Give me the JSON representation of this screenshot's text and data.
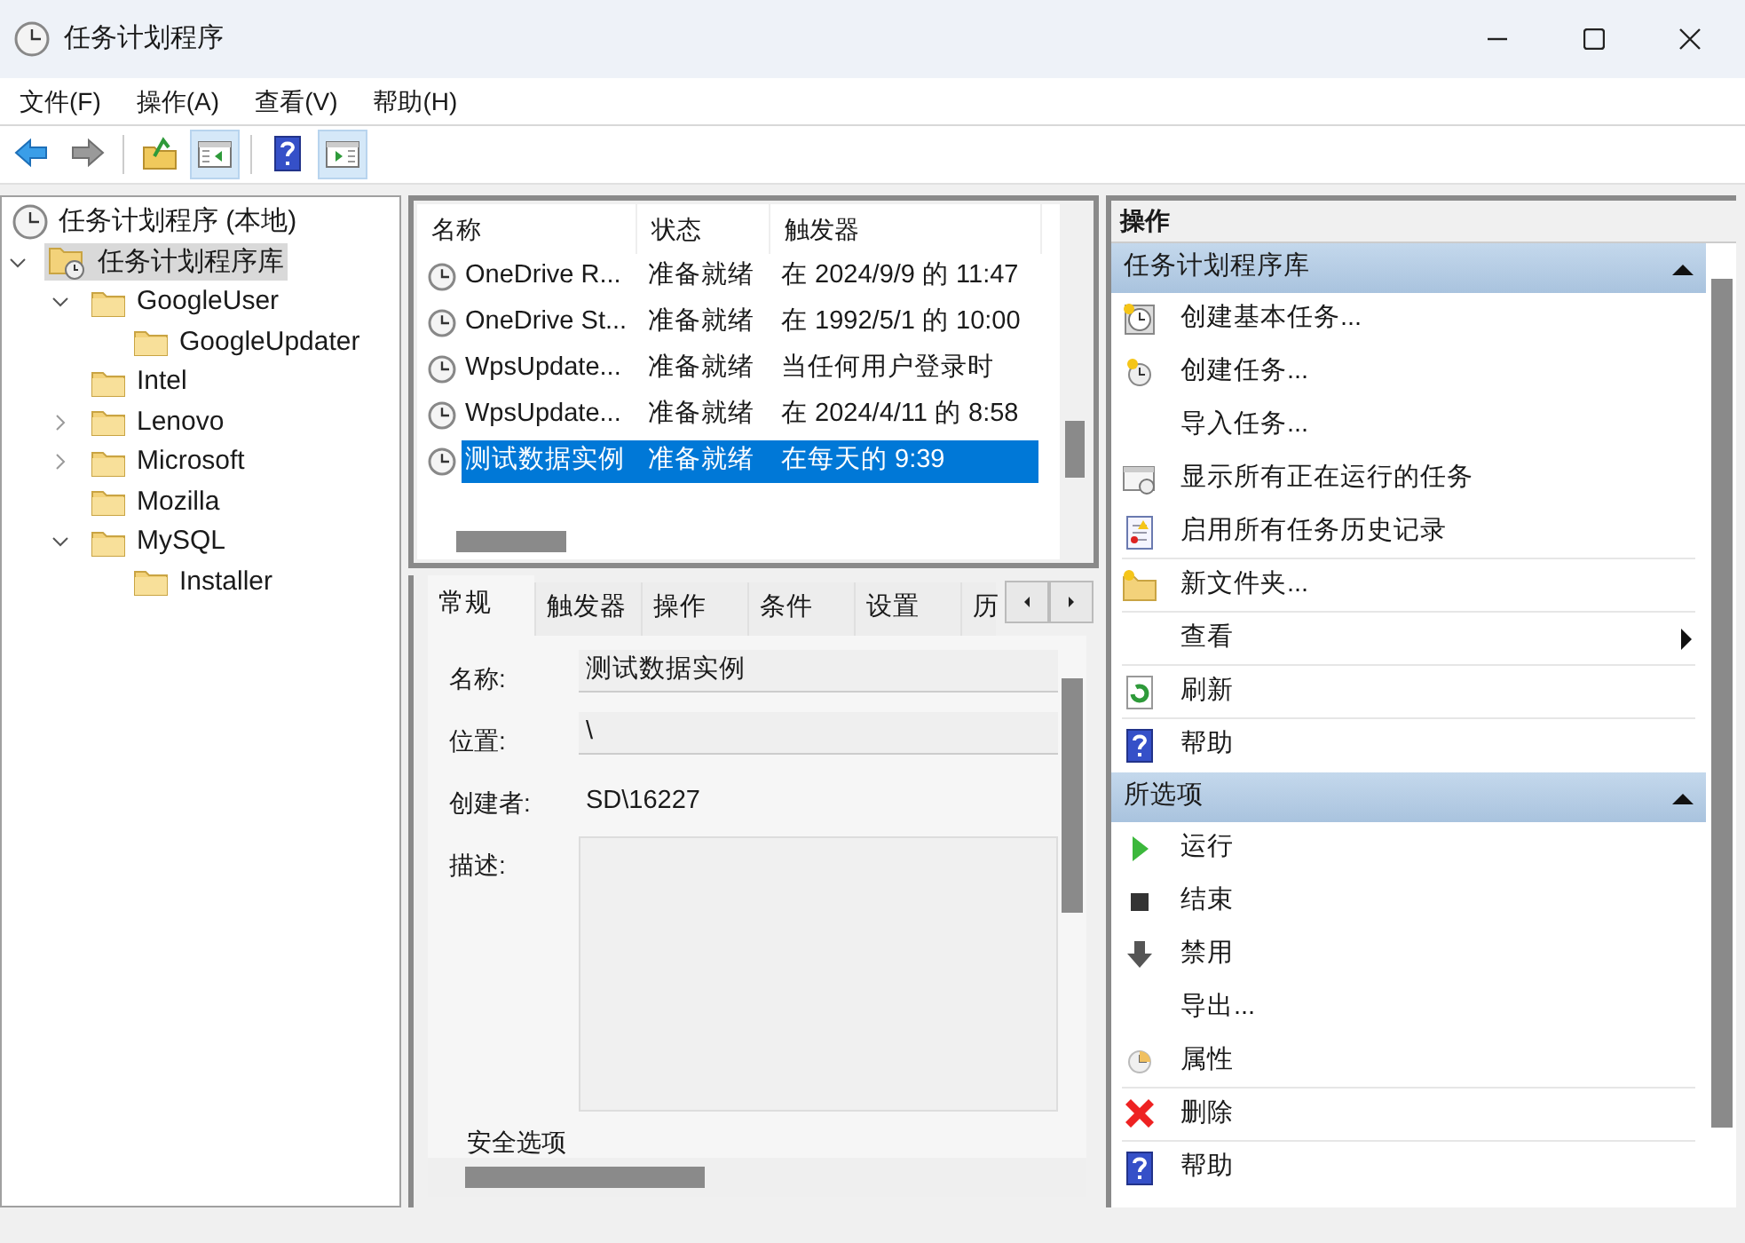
{
  "window": {
    "title": "任务计划程序"
  },
  "menu": [
    "文件(F)",
    "操作(A)",
    "查看(V)",
    "帮助(H)"
  ],
  "toolbar": [
    {
      "kind": "back",
      "pressed": false
    },
    {
      "kind": "forward",
      "pressed": false
    },
    {
      "kind": "up",
      "pressed": false
    },
    {
      "kind": "tree-pane",
      "pressed": true
    },
    {
      "kind": "help",
      "pressed": false
    },
    {
      "kind": "action-pane",
      "pressed": true
    }
  ],
  "tree": [
    {
      "label": "任务计划程序 (本地)",
      "kind": "root",
      "selected": false,
      "children": [
        {
          "label": "任务计划程序库",
          "kind": "library",
          "expanded": true,
          "selected": true,
          "children": [
            {
              "label": "GoogleUser",
              "kind": "folder",
              "expanded": true,
              "selected": false,
              "children": [
                {
                  "label": "GoogleUpdater",
                  "kind": "folder",
                  "selected": false
                }
              ]
            },
            {
              "label": "Intel",
              "kind": "folder",
              "selected": false
            },
            {
              "label": "Lenovo",
              "kind": "folder",
              "expanded": false,
              "selected": false
            },
            {
              "label": "Microsoft",
              "kind": "folder",
              "expanded": false,
              "selected": false
            },
            {
              "label": "Mozilla",
              "kind": "folder",
              "selected": false
            },
            {
              "label": "MySQL",
              "kind": "folder",
              "expanded": true,
              "selected": false,
              "children": [
                {
                  "label": "Installer",
                  "kind": "folder",
                  "selected": false
                }
              ]
            }
          ]
        }
      ]
    }
  ],
  "task_list": {
    "columns": [
      "名称",
      "状态",
      "触发器"
    ],
    "rows": [
      {
        "name": "OneDrive R...",
        "status": "准备就绪",
        "trigger": "在 2024/9/9 的 11:47",
        "selected": false
      },
      {
        "name": "OneDrive St...",
        "status": "准备就绪",
        "trigger": "在 1992/5/1 的 10:00",
        "selected": false
      },
      {
        "name": "WpsUpdate...",
        "status": "准备就绪",
        "trigger": "当任何用户登录时",
        "selected": false
      },
      {
        "name": "WpsUpdate...",
        "status": "准备就绪",
        "trigger": "在 2024/4/11 的 8:58",
        "selected": false
      },
      {
        "name": "测试数据实例",
        "status": "准备就绪",
        "trigger": "在每天的 9:39",
        "selected": true
      }
    ]
  },
  "details": {
    "tabs": [
      {
        "label": "常规",
        "selected": true
      },
      {
        "label": "触发器",
        "selected": false
      },
      {
        "label": "操作",
        "selected": false
      },
      {
        "label": "条件",
        "selected": false
      },
      {
        "label": "设置",
        "selected": false
      },
      {
        "label": "历",
        "selected": false
      }
    ],
    "fields": [
      {
        "label": "名称:",
        "value": "测试数据实例",
        "kind": "field"
      },
      {
        "label": "位置:",
        "value": "\\",
        "kind": "field"
      },
      {
        "label": "创建者:",
        "value": "SD\\16227",
        "kind": "text"
      },
      {
        "label": "描述:",
        "kind": "area"
      }
    ],
    "section": "安全选项"
  },
  "actions": {
    "title": "操作",
    "sections": [
      {
        "title": "任务计划程序库",
        "expanded": true,
        "items": [
          {
            "label": "创建基本任务...",
            "kind": "basic-task",
            "submenu": false,
            "divider": false
          },
          {
            "label": "创建任务...",
            "kind": "task",
            "submenu": false,
            "divider": false
          },
          {
            "label": "导入任务...",
            "kind": "plain",
            "submenu": false,
            "divider": false
          },
          {
            "label": "显示所有正在运行的任务",
            "kind": "running",
            "submenu": false,
            "divider": false
          },
          {
            "label": "启用所有任务历史记录",
            "kind": "history",
            "submenu": false,
            "divider": true
          },
          {
            "label": "新文件夹...",
            "kind": "new-folder",
            "submenu": false,
            "divider": true
          },
          {
            "label": "查看",
            "kind": "plain",
            "submenu": true,
            "divider": true
          },
          {
            "label": "刷新",
            "kind": "refresh",
            "submenu": false,
            "divider": true
          },
          {
            "label": "帮助",
            "kind": "help",
            "submenu": false,
            "divider": false
          }
        ]
      },
      {
        "title": "所选项",
        "expanded": true,
        "items": [
          {
            "label": "运行",
            "kind": "run",
            "submenu": false,
            "divider": false
          },
          {
            "label": "结束",
            "kind": "stop",
            "submenu": false,
            "divider": false
          },
          {
            "label": "禁用",
            "kind": "disable",
            "submenu": false,
            "divider": false
          },
          {
            "label": "导出...",
            "kind": "plain",
            "submenu": false,
            "divider": false
          },
          {
            "label": "属性",
            "kind": "properties",
            "submenu": false,
            "divider": true
          },
          {
            "label": "删除",
            "kind": "delete",
            "submenu": false,
            "divider": true
          },
          {
            "label": "帮助",
            "kind": "help",
            "submenu": false,
            "divider": false
          }
        ]
      }
    ]
  }
}
